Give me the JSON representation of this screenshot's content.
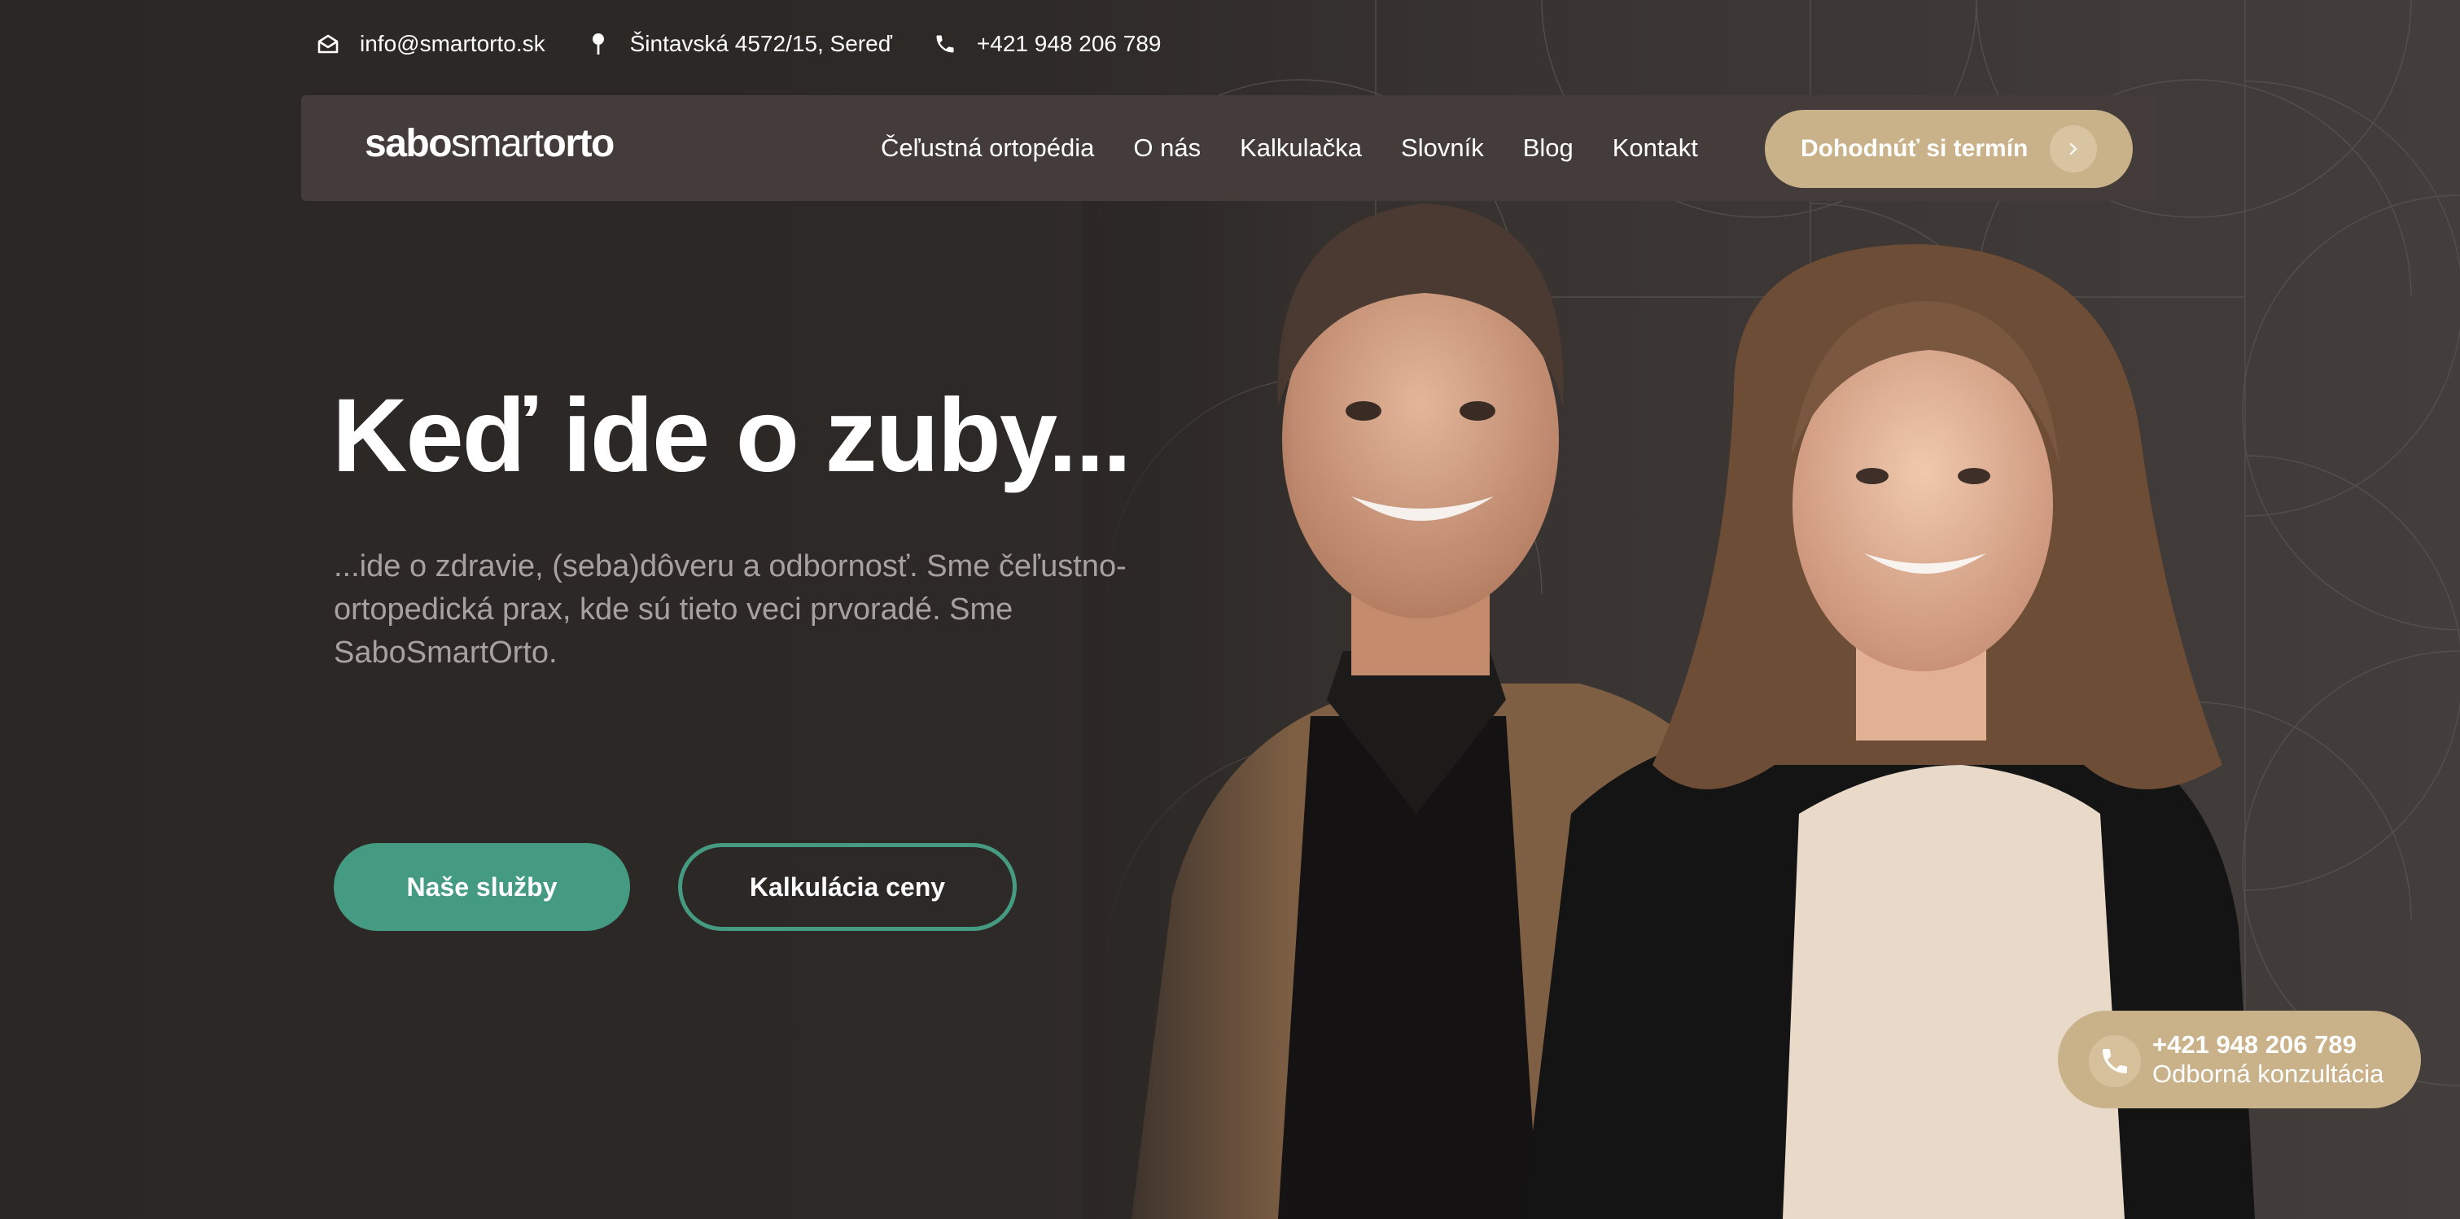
{
  "topbar": {
    "email": "info@smartorto.sk",
    "address": "Šintavská 4572/15, Sereď",
    "phone": "+421 948 206 789"
  },
  "logo": {
    "part1": "sabo",
    "part2": "smart",
    "part3": "orto"
  },
  "nav": {
    "items": [
      {
        "label": "Čeľustná ortopédia"
      },
      {
        "label": "O nás"
      },
      {
        "label": "Kalkulačka"
      },
      {
        "label": "Slovník"
      },
      {
        "label": "Blog"
      },
      {
        "label": "Kontakt"
      }
    ],
    "cta_label": "Dohodnúť si termín"
  },
  "hero": {
    "title": "Keď ide o zuby...",
    "subtitle": "...ide o zdravie, (seba)dôveru a odbornosť. Sme čeľustno-ortopedická prax, kde sú tieto veci prvoradé. Sme SaboSmartOrto.",
    "btn_services": "Naše služby",
    "btn_calc": "Kalkulácia ceny"
  },
  "float_contact": {
    "phone": "+421 948 206 789",
    "label": "Odborná konzultácia"
  },
  "colors": {
    "background": "#2e2a28",
    "navbar": "#433c3a",
    "gold": "#c9b28a",
    "green": "#459b82",
    "text_muted": "#a8a29f"
  },
  "icons": {
    "email": "envelope-icon",
    "address": "location-pin-icon",
    "phone": "phone-icon",
    "cta_arrow": "chevron-right-icon"
  }
}
